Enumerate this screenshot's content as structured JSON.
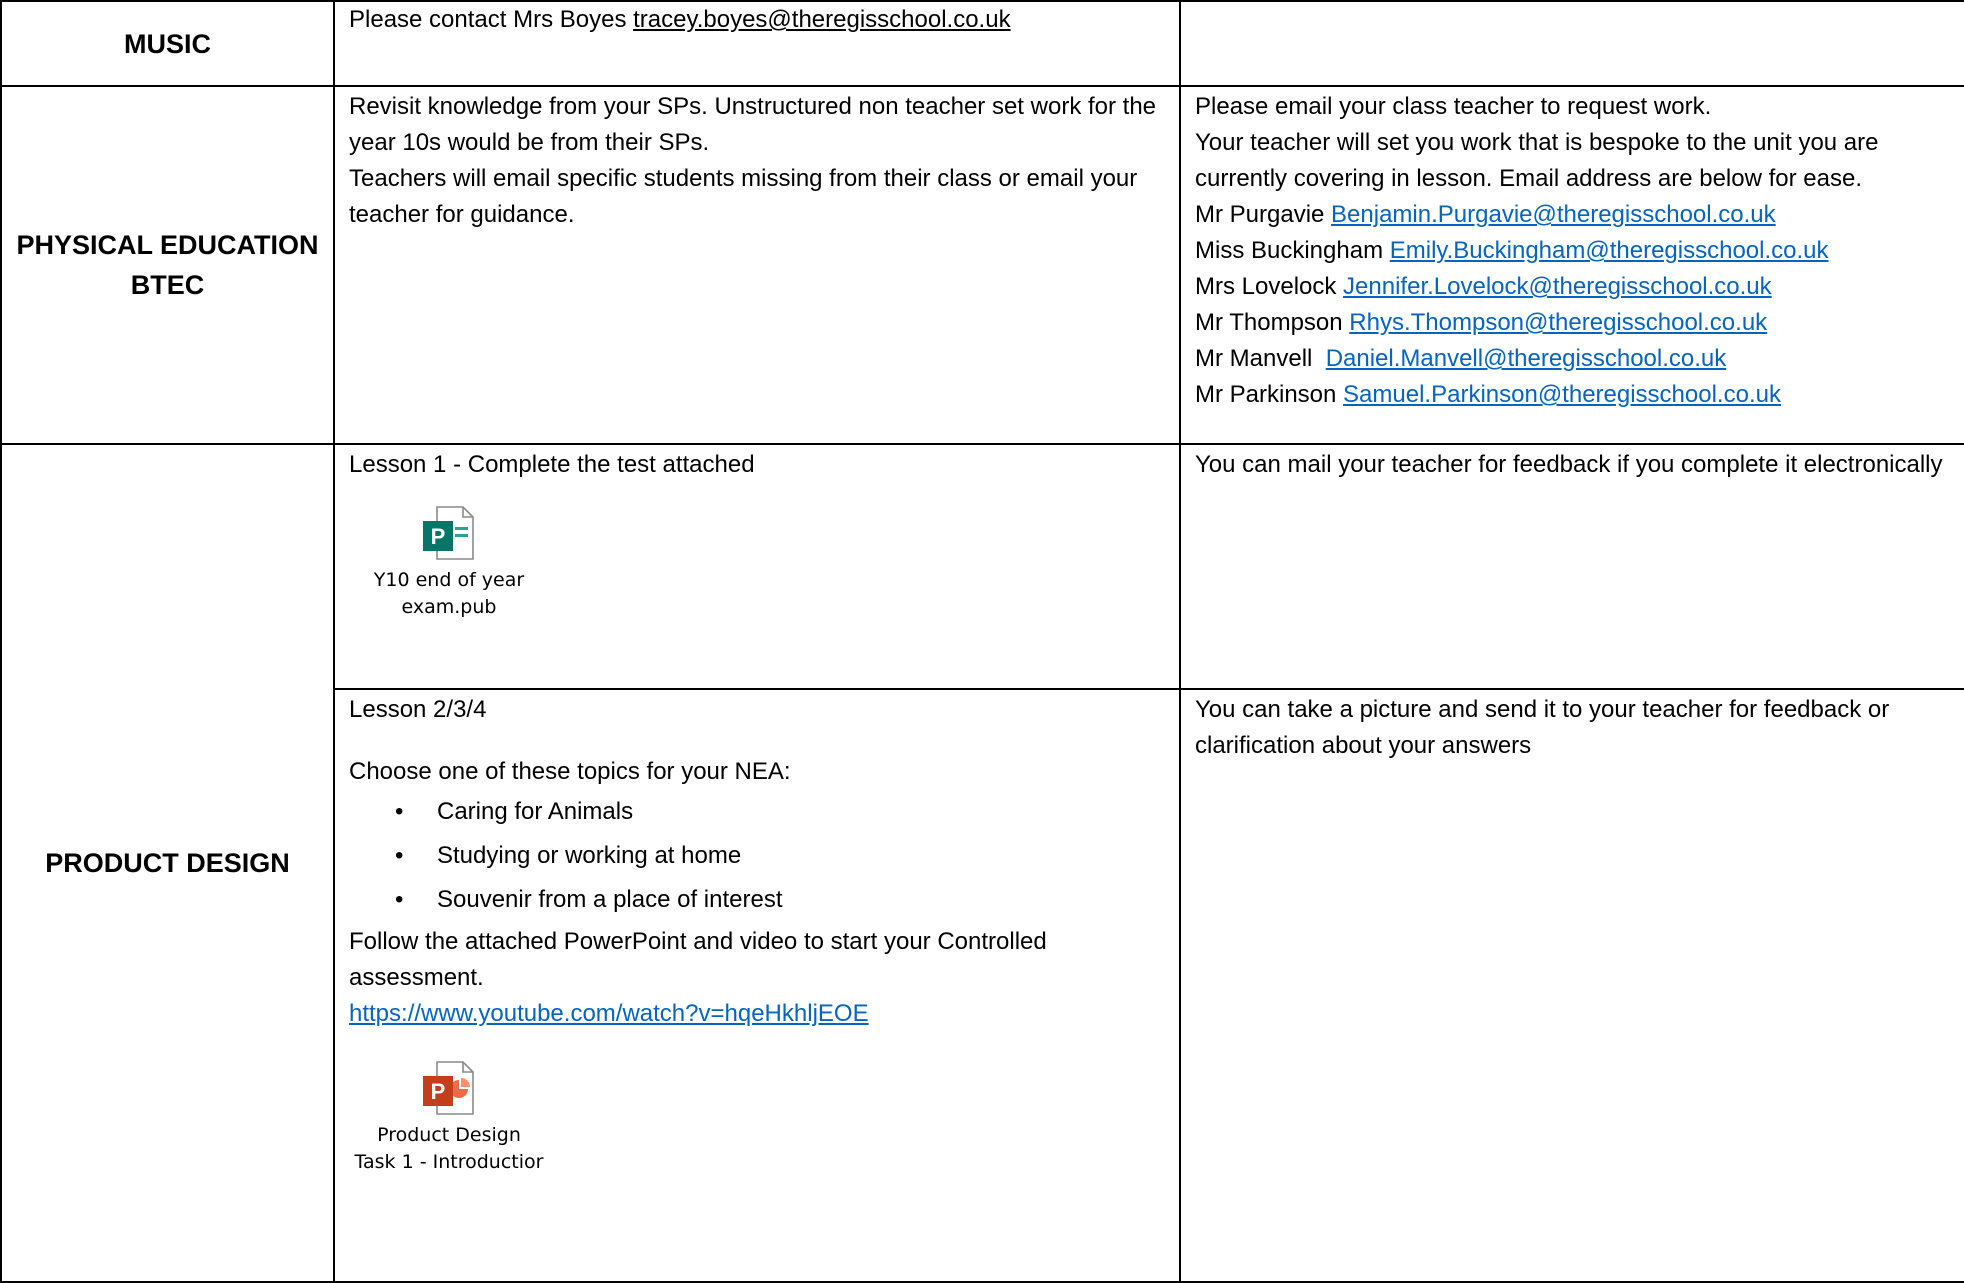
{
  "rows": {
    "music": {
      "subject": "MUSIC",
      "text": "Please contact Mrs Boyes ",
      "email": "tracey.boyes@theregisschool.co.uk"
    },
    "pe": {
      "subject_line1": "PHYSICAL EDUCATION",
      "subject_line2": "BTEC",
      "col2": [
        "Revisit knowledge from your SPs. Unstructured non teacher set work for the year 10s would be from their SPs.",
        "Teachers will email specific students missing from their class or email your teacher for guidance."
      ],
      "col3_intro": [
        "Please email your class teacher to request work.",
        "Your teacher will set you work that is bespoke to the unit you are currently covering in lesson. Email address are below for ease."
      ],
      "teachers": [
        {
          "name": "Mr Purgavie ",
          "email": "Benjamin.Purgavie@theregisschool.co.uk"
        },
        {
          "name": "Miss Buckingham ",
          "email": "Emily.Buckingham@theregisschool.co.uk"
        },
        {
          "name": "Mrs Lovelock ",
          "email": "Jennifer.Lovelock@theregisschool.co.uk"
        },
        {
          "name": "Mr Thompson ",
          "email": "Rhys.Thompson@theregisschool.co.uk"
        },
        {
          "name": "Mr Manvell  ",
          "email": "Daniel.Manvell@theregisschool.co.uk"
        },
        {
          "name": "Mr Parkinson ",
          "email": "Samuel.Parkinson@theregisschool.co.uk"
        }
      ]
    },
    "pd": {
      "subject": "PRODUCT DESIGN",
      "lesson1": {
        "title": "Lesson 1 - Complete the test attached",
        "attachment_line1": "Y10 end of year",
        "attachment_line2": "exam.pub",
        "attachment_icon": "publisher-file-icon",
        "feedback": "You can mail your teacher for feedback if you complete it electronically"
      },
      "lesson2": {
        "title": "Lesson 2/3/4",
        "prompt": "Choose one of these topics for your NEA:",
        "topics": [
          "Caring for Animals",
          "Studying or working at home",
          "Souvenir from a place of interest"
        ],
        "instruction": "Follow the attached PowerPoint and video to start your Controlled assessment.",
        "video_url": "https://www.youtube.com/watch?v=hqeHkhljEOE",
        "attachment_line1": "Product Design",
        "attachment_line2": "Task 1 - Introductior",
        "attachment_icon": "powerpoint-file-icon",
        "feedback": "You can take a picture and send it to your teacher for feedback or clarification about your answers"
      }
    }
  },
  "colors": {
    "link": "#0563c1",
    "publisher": "#077568",
    "powerpoint": "#c43e1c",
    "border": "#000000"
  }
}
